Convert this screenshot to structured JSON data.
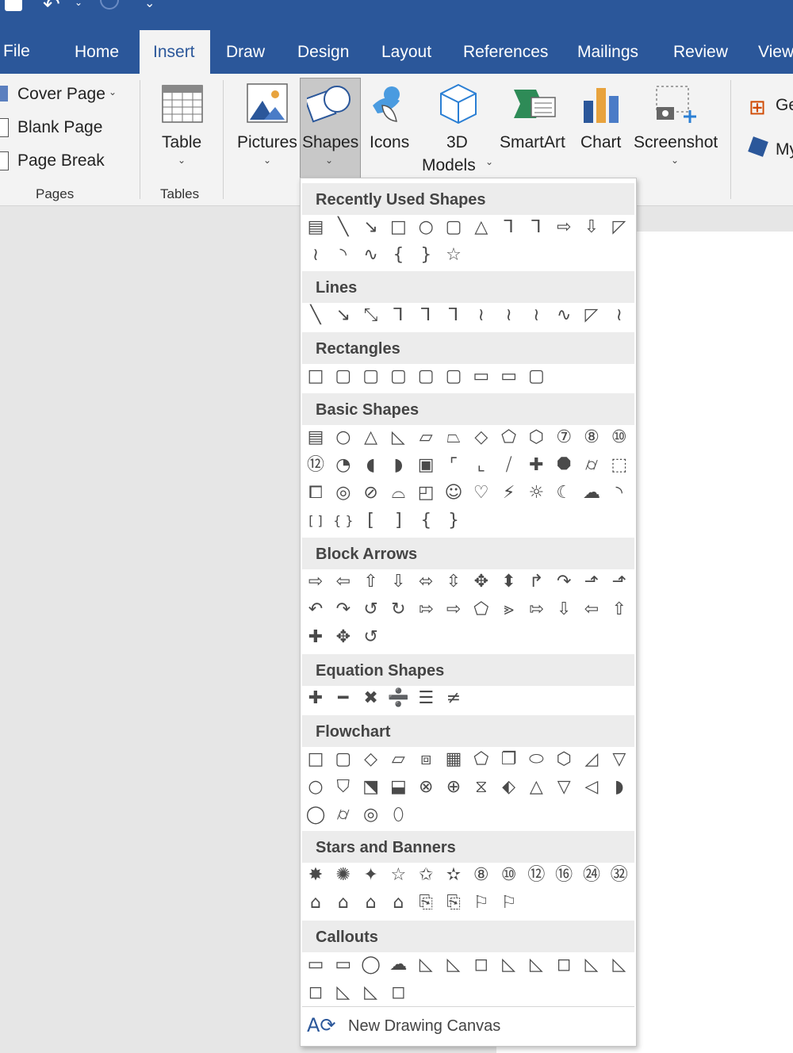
{
  "tabs": [
    "File",
    "Home",
    "Insert",
    "Draw",
    "Design",
    "Layout",
    "References",
    "Mailings",
    "Review",
    "View"
  ],
  "pages_group": {
    "label": "Pages",
    "items": [
      "Cover Page",
      "Blank Page",
      "Page Break"
    ]
  },
  "tables_group": {
    "label": "Tables",
    "button": "Table"
  },
  "illustrations": {
    "pictures": "Pictures",
    "shapes": "Shapes",
    "icons": "Icons",
    "models_line1": "3D",
    "models_line2": "Models",
    "smartart": "SmartArt",
    "chart": "Chart",
    "screenshot": "Screenshot"
  },
  "addins": {
    "get": "Ge",
    "my": "My"
  },
  "shapes_menu": {
    "sections": [
      {
        "title": "Recently Used Shapes",
        "rows": [
          [
            "▤",
            "╲",
            "↘",
            "□",
            "○",
            "▢",
            "△",
            "⅂",
            "⅂",
            "⇨",
            "⇩",
            "◸"
          ],
          [
            "≀",
            "◝",
            "∿",
            "{",
            "}",
            "☆"
          ]
        ]
      },
      {
        "title": "Lines",
        "rows": [
          [
            "╲",
            "↘",
            "⤡",
            "⅂",
            "⅂",
            "⅂",
            "≀",
            "≀",
            "≀",
            "∿",
            "◸",
            "≀"
          ]
        ]
      },
      {
        "title": "Rectangles",
        "rows": [
          [
            "□",
            "▢",
            "▢",
            "▢",
            "▢",
            "▢",
            "▭",
            "▭",
            "▢"
          ]
        ]
      },
      {
        "title": "Basic Shapes",
        "rows": [
          [
            "▤",
            "○",
            "△",
            "◺",
            "▱",
            "⏢",
            "◇",
            "⬠",
            "⬡",
            "⑦",
            "⑧",
            "⑩"
          ],
          [
            "⑫",
            "◔",
            "◖",
            "◗",
            "▣",
            "⌜",
            "⌞",
            "⧸",
            "✚",
            "⯃",
            "⌭",
            "⬚"
          ],
          [
            "⧠",
            "◎",
            "⊘",
            "⌓",
            "◰",
            "☺",
            "♡",
            "⚡",
            "☼",
            "☾",
            "☁",
            "◝"
          ],
          [
            "[ ]",
            "{ }",
            "[",
            "]",
            "{",
            "}"
          ]
        ]
      },
      {
        "title": "Block Arrows",
        "rows": [
          [
            "⇨",
            "⇦",
            "⇧",
            "⇩",
            "⬄",
            "⇳",
            "✥",
            "⬍",
            "↱",
            "↷",
            "⬏",
            "⬏"
          ],
          [
            "↶",
            "↷",
            "↺",
            "↻",
            "⇰",
            "⇨",
            "⬠",
            "⪢",
            "⇰",
            "⇩",
            "⇦",
            "⇧"
          ],
          [
            "✚",
            "✥",
            "↺"
          ]
        ]
      },
      {
        "title": "Equation Shapes",
        "rows": [
          [
            "✚",
            "━",
            "✖",
            "➗",
            "☰",
            "≠"
          ]
        ]
      },
      {
        "title": "Flowchart",
        "rows": [
          [
            "□",
            "▢",
            "◇",
            "▱",
            "⧈",
            "▦",
            "⬠",
            "❐",
            "⬭",
            "⬡",
            "◿",
            "▽"
          ],
          [
            "○",
            "⛉",
            "⬔",
            "⬓",
            "⊗",
            "⊕",
            "⧖",
            "⬖",
            "△",
            "▽",
            "◁",
            "◗"
          ],
          [
            "◯",
            "⌭",
            "◎",
            "⬯"
          ]
        ]
      },
      {
        "title": "Stars and Banners",
        "rows": [
          [
            "✸",
            "✺",
            "✦",
            "☆",
            "✩",
            "✫",
            "⑧",
            "⑩",
            "⑫",
            "⑯",
            "㉔",
            "㉜"
          ],
          [
            "⌂",
            "⌂",
            "⌂",
            "⌂",
            "⎘",
            "⎘",
            "⚐",
            "⚐"
          ]
        ]
      },
      {
        "title": "Callouts",
        "rows": [
          [
            "▭",
            "▭",
            "◯",
            "☁",
            "◺",
            "◺",
            "◻",
            "◺",
            "◺",
            "◻",
            "◺",
            "◺"
          ],
          [
            "◻",
            "◺",
            "◺",
            "◻"
          ]
        ]
      }
    ],
    "footer": "New Drawing Canvas"
  }
}
